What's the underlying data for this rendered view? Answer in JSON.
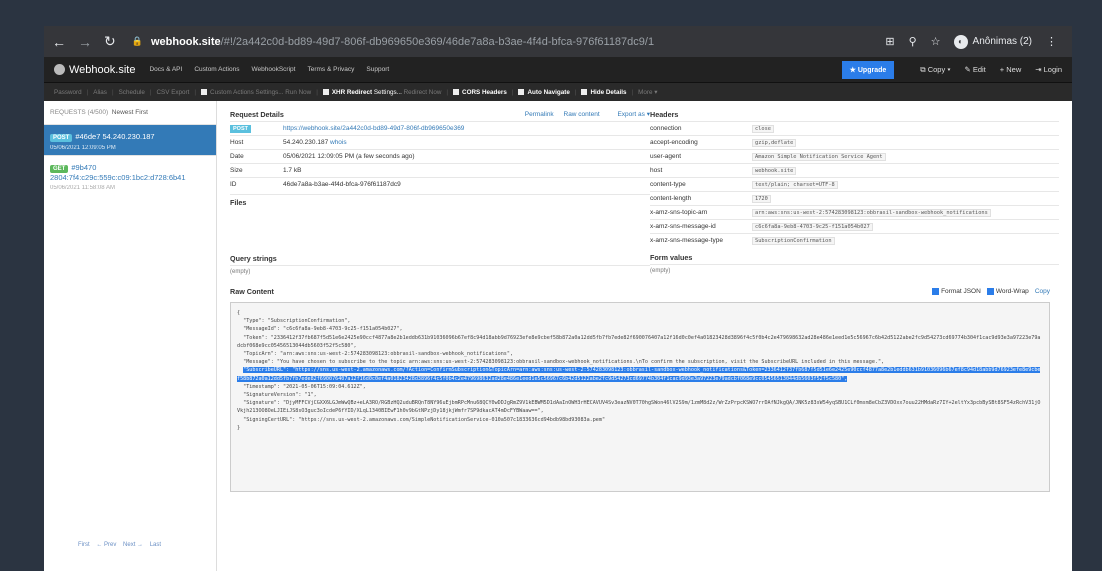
{
  "browser": {
    "url_host": "webhook.site",
    "url_path": "/#!/2a442c0d-bd89-49d7-806f-db969650e369/46de7a8a-b3ae-4f4d-bfca-976f61187dc9/1",
    "profile_label": "Anônimas (2)"
  },
  "navbar": {
    "brand": "Webhook.site",
    "links": [
      "Docs & API",
      "Custom Actions",
      "WebhookScript",
      "Terms & Privacy",
      "Support"
    ],
    "upgrade": "Upgrade",
    "copy": "Copy",
    "edit": "Edit",
    "new": "New",
    "login": "Login"
  },
  "toolbar": {
    "plain": [
      "Password",
      "Alias",
      "Schedule",
      "CSV Export"
    ],
    "custom_actions": "Custom Actions Settings...",
    "run_now": "Run Now",
    "xhr": "XHR Redirect",
    "xhr_settings": "Settings...",
    "redirect_now": "Redirect Now",
    "cors": "CORS Headers",
    "auto_navigate": "Auto Navigate",
    "hide_details": "Hide Details",
    "more": "More"
  },
  "sidebar": {
    "requests_label": "REQUESTS (4/500)",
    "sort_label": "Newest First",
    "requests": [
      {
        "method": "POST",
        "summary": "#46de7 54.240.230.187",
        "time": "05/06/2021 12:09:05 PM"
      },
      {
        "method": "GET",
        "summary": "#9b470",
        "host": "2804:7f4:c29c:559c:c09:1bc2:d728:6b41",
        "time": "05/06/2021 11:58:08 AM"
      }
    ],
    "pager": [
      "First",
      "← Prev",
      "Next →",
      "Last"
    ]
  },
  "details": {
    "title": "Request Details",
    "actions": [
      "Permalink",
      "Raw content",
      "Export as"
    ],
    "method": "POST",
    "url": "https://webhook.site/2a442c0d-bd89-49d7-806f-db969650e369",
    "host_label": "Host",
    "host": "54.240.230.187",
    "whois": "whois",
    "date_label": "Date",
    "date": "05/06/2021 12:09:05 PM (a few seconds ago)",
    "size_label": "Size",
    "size": "1.7 kB",
    "id_label": "ID",
    "id": "46de7a8a-b3ae-4f4d-bfca-976f61187dc9",
    "files_label": "Files"
  },
  "headers": {
    "title": "Headers",
    "rows": [
      {
        "k": "connection",
        "v": "close"
      },
      {
        "k": "accept-encoding",
        "v": "gzip,deflate"
      },
      {
        "k": "user-agent",
        "v": "Amazon Simple Notification Service Agent"
      },
      {
        "k": "host",
        "v": "webhook.site"
      },
      {
        "k": "content-type",
        "v": "text/plain; charset=UTF-8"
      },
      {
        "k": "content-length",
        "v": "1720"
      },
      {
        "k": "x-amz-sns-topic-arn",
        "v": "arn:aws:sns:us-west-2:574283098123:obbrasil-sandbox-webhook_notifications"
      },
      {
        "k": "x-amz-sns-message-id",
        "v": "c6c6fa8a-9eb8-4703-9c25-f151a054b027"
      },
      {
        "k": "x-amz-sns-message-type",
        "v": "SubscriptionConfirmation"
      }
    ]
  },
  "query": {
    "title": "Query strings",
    "value": "(empty)"
  },
  "form": {
    "title": "Form values",
    "value": "(empty)"
  },
  "raw": {
    "title": "Raw Content",
    "format_json": "Format JSON",
    "word_wrap": "Word-Wrap",
    "copy": "Copy",
    "before": "{\n  \"Type\": \"SubscriptionConfirmation\",\n  \"MessageId\": \"c6c6fa8a-9eb8-4703-9c25-f151a054b027\",\n  \"Token\": \"2336412f37fb687f5d51e6e2425e90ccf4877a8e2b1eddb631b91036096b67ef8c94d18abb9d76923efe8e9cbef58b872a0a12dd5fb7fb7ede82f690076407a12f16d0c0ef4a01823428d3896f4c5f0b4c2e479698632ad28e486e1eed1e5c56967c6b42d5122abe2fc9d54273cd69774b304f1cac9d93e3a97223e79adcbf068e9cc05456513044db5603f52f5c580\",\n  \"TopicArn\": \"arn:aws:sns:us-west-2:574283098123:obbrasil-sandbox-webhook_notifications\",\n  \"Message\": \"You have chosen to subscribe to the topic arn:aws:sns:us-west-2:574283098123:obbrasil-sandbox-webhook_notifications.\\nTo confirm the subscription, visit the SubscribeURL included in this message.\",\n  ",
    "highlight": "\"SubscribeURL\": \"https://sns.us-west-2.amazonaws.com/?Action=ConfirmSubscription&TopicArn=arn:aws:sns:us-west-2:574283098123:obbrasil-sandbox-webhook_notifications&Token=2336412f37fb687f5d51e6e2425e90ccf4877a8e2b1eddb631b91036096b67ef8c94d18abb9d76923efe8e9cbef58b872a0a12dd5fb7fb7ede82f690076407a12f16d0c0ef4a01823428d3896f4c5f0b4c2e479698632ad28e486e1eed1e5c56967c6b42d5122abe2fc9d54273cd69774b304f1cac9d93e3a97223e79adcbf068e9cc05456513044db5603f52f5c580\",",
    "after": "\n  \"Timestamp\": \"2021-05-06T15:09:04.612Z\",\n  \"SignatureVersion\": \"1\",\n  \"Signature\": \"DjyMFFCVjCGXX6LGJmWwQBz+eLA3RO/RGBzHQ2uduBRQnT8NY96uEjbmRPcMnu68QCY0wDDJgRmZ9V1kEBWM5D1dAaInOWH3rHECAVUV4Sv3eazNV0T70hgSWon46lV2S9m/1zmM8d2z/WrZzPrpcKSWO7rrDAfNJkgQA/JNK5z83sW54yqSBU1CLf0msm8eCbZ3VDOxx7ouu22HMdaRz7IY+2eltYx3pcbBySBt8SF54zRchV31jOVkjh213OO8OeLJIEiJS8sO3guc3oIcdeP6fYID/XLqL1340BIEwF1h0v9bGtNPzjDy18jkjWmfr7SP9dkacAT4mDcFYBWaaw==\",\n  \"SigningCertURL\": \"https://sns.us-west-2.amazonaws.com/SimpleNotificationService-010a507c1833636cd94bdb98bd93083a.pem\"\n}"
  }
}
